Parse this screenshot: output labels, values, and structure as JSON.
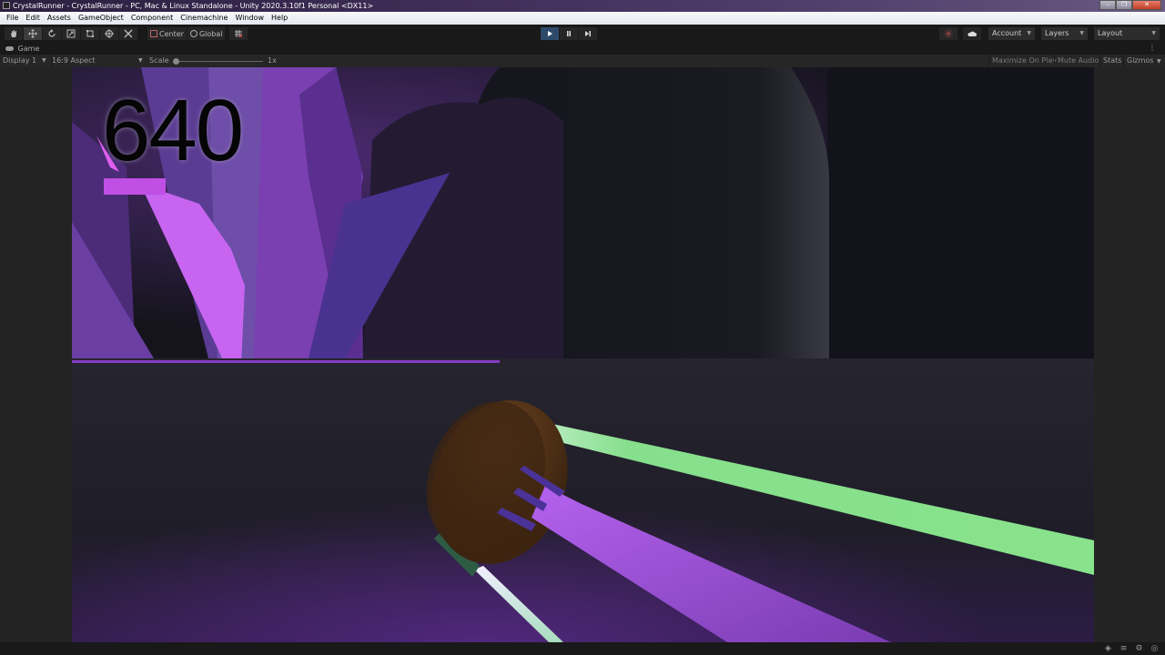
{
  "window": {
    "title": "CrystalRunner - CrystalRunner - PC, Mac & Linux Standalone - Unity 2020.3.10f1 Personal <DX11>",
    "controls": {
      "minimize": "–",
      "restore": "❐",
      "close": "✕"
    }
  },
  "menu": [
    "File",
    "Edit",
    "Assets",
    "GameObject",
    "Component",
    "Cinemachine",
    "Window",
    "Help"
  ],
  "toolbar": {
    "tools": [
      {
        "name": "hand-tool",
        "icon": "hand-icon"
      },
      {
        "name": "move-tool",
        "icon": "move-icon",
        "active": true
      },
      {
        "name": "rotate-tool",
        "icon": "rotate-icon"
      },
      {
        "name": "scale-tool",
        "icon": "scale-icon"
      },
      {
        "name": "rect-tool",
        "icon": "rect-icon"
      },
      {
        "name": "transform-tool",
        "icon": "transform-icon"
      },
      {
        "name": "custom-tool",
        "icon": "tools-icon"
      }
    ],
    "pivot_mode": "Center",
    "pivot_rotation": "Global",
    "snap_icon": "grid-snap-icon",
    "play": "play-icon",
    "pause": "pause-icon",
    "step": "step-icon",
    "collab_icon": "collab-icon",
    "cloud_icon": "cloud-icon",
    "account": "Account",
    "layers": "Layers",
    "layout": "Layout"
  },
  "game_view": {
    "tab_label": "Game",
    "display": "Display 1",
    "aspect": "16:9 Aspect",
    "scale_label": "Scale",
    "scale_value": "1x",
    "scale_fraction": 0.0,
    "maximize_on_play": "Maximize On Play",
    "mute_audio": "Mute Audio",
    "stats": "Stats",
    "gizmos": "Gizmos"
  },
  "game": {
    "score": "640",
    "colors": {
      "crystal_light": "#b25cf0",
      "crystal_mid": "#6a3fa0",
      "crystal_dark": "#3b2460",
      "rail_green": "#88e08e",
      "rail_purple": "#9b4fd0",
      "barrel": "#5a3414",
      "floor": "#26242e"
    }
  },
  "statusbar": {
    "icons": [
      "progress-icon",
      "stack-icon",
      "cache-icon",
      "status-icon"
    ]
  }
}
